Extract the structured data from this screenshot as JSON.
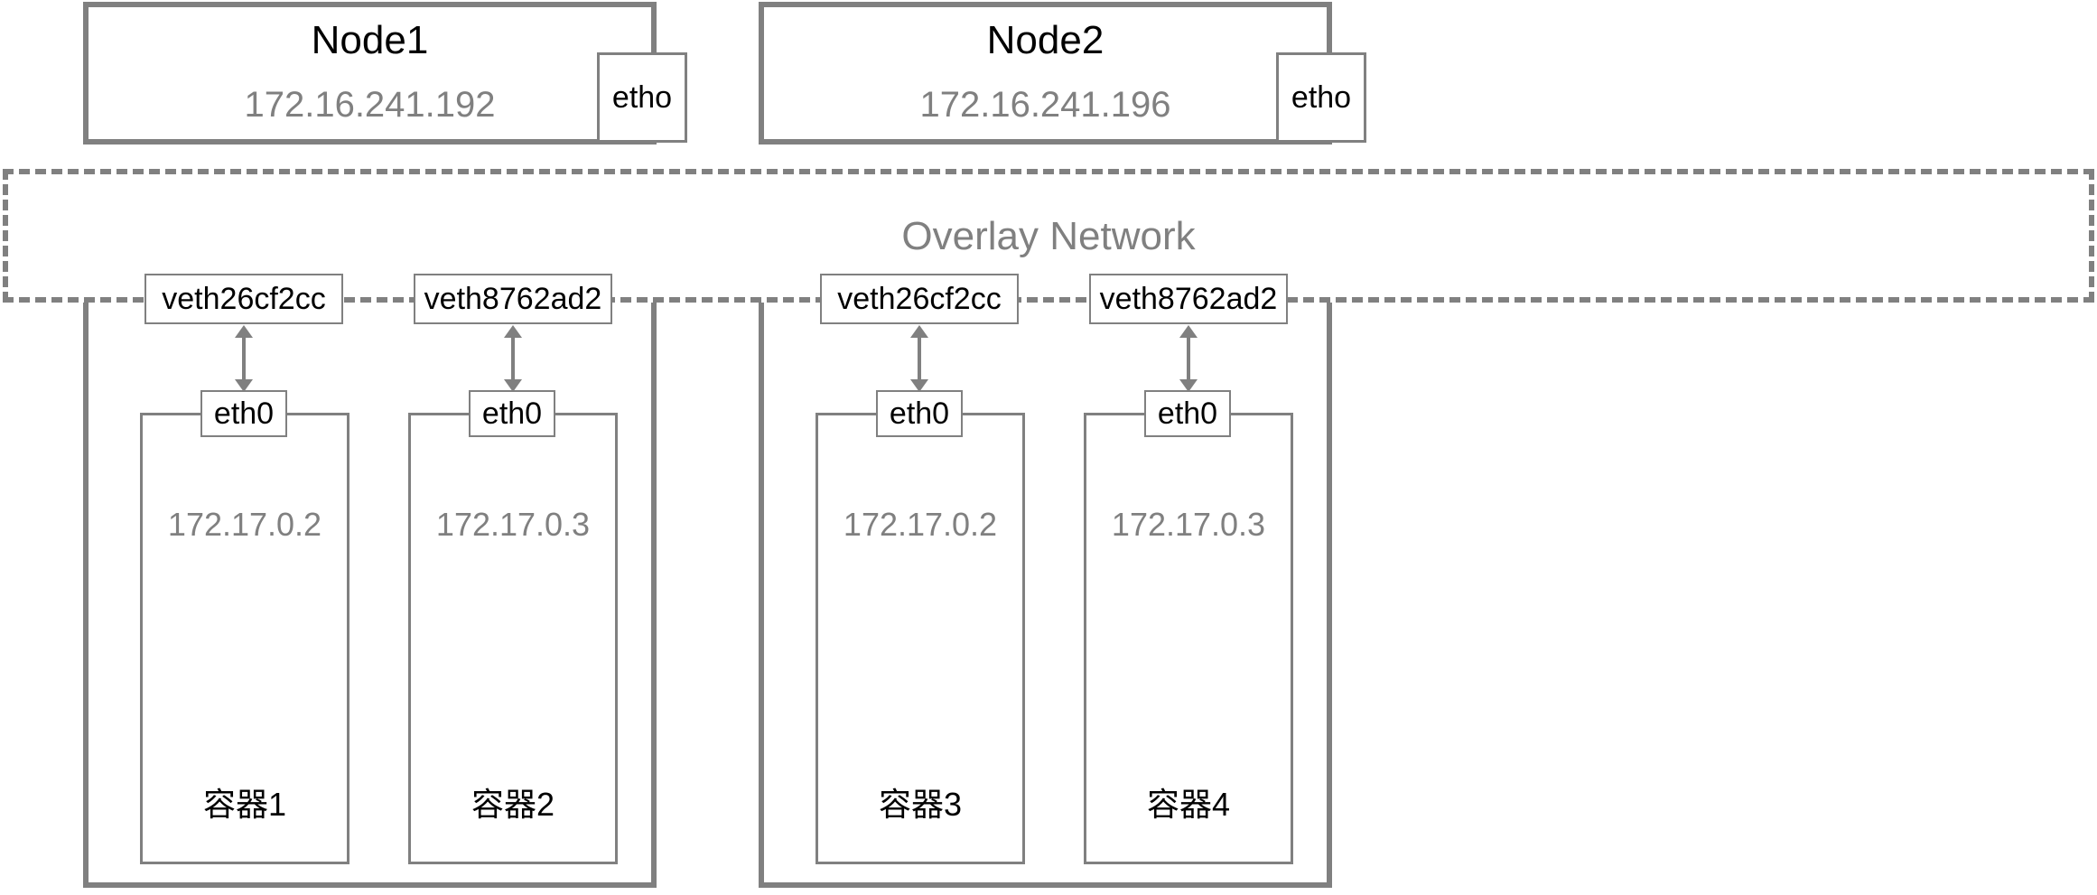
{
  "nodes": [
    {
      "title": "Node1",
      "ip": "172.16.241.192",
      "etho_label": "etho",
      "containers": [
        {
          "veth": "veth26cf2cc",
          "eth0": "eth0",
          "ip": "172.17.0.2",
          "name": "容器1"
        },
        {
          "veth": "veth8762ad2",
          "eth0": "eth0",
          "ip": "172.17.0.3",
          "name": "容器2"
        }
      ]
    },
    {
      "title": "Node2",
      "ip": "172.16.241.196",
      "etho_label": "etho",
      "containers": [
        {
          "veth": "veth26cf2cc",
          "eth0": "eth0",
          "ip": "172.17.0.2",
          "name": "容器3"
        },
        {
          "veth": "veth8762ad2",
          "eth0": "eth0",
          "ip": "172.17.0.3",
          "name": "容器4"
        }
      ]
    }
  ],
  "overlay_label": "Overlay Network"
}
